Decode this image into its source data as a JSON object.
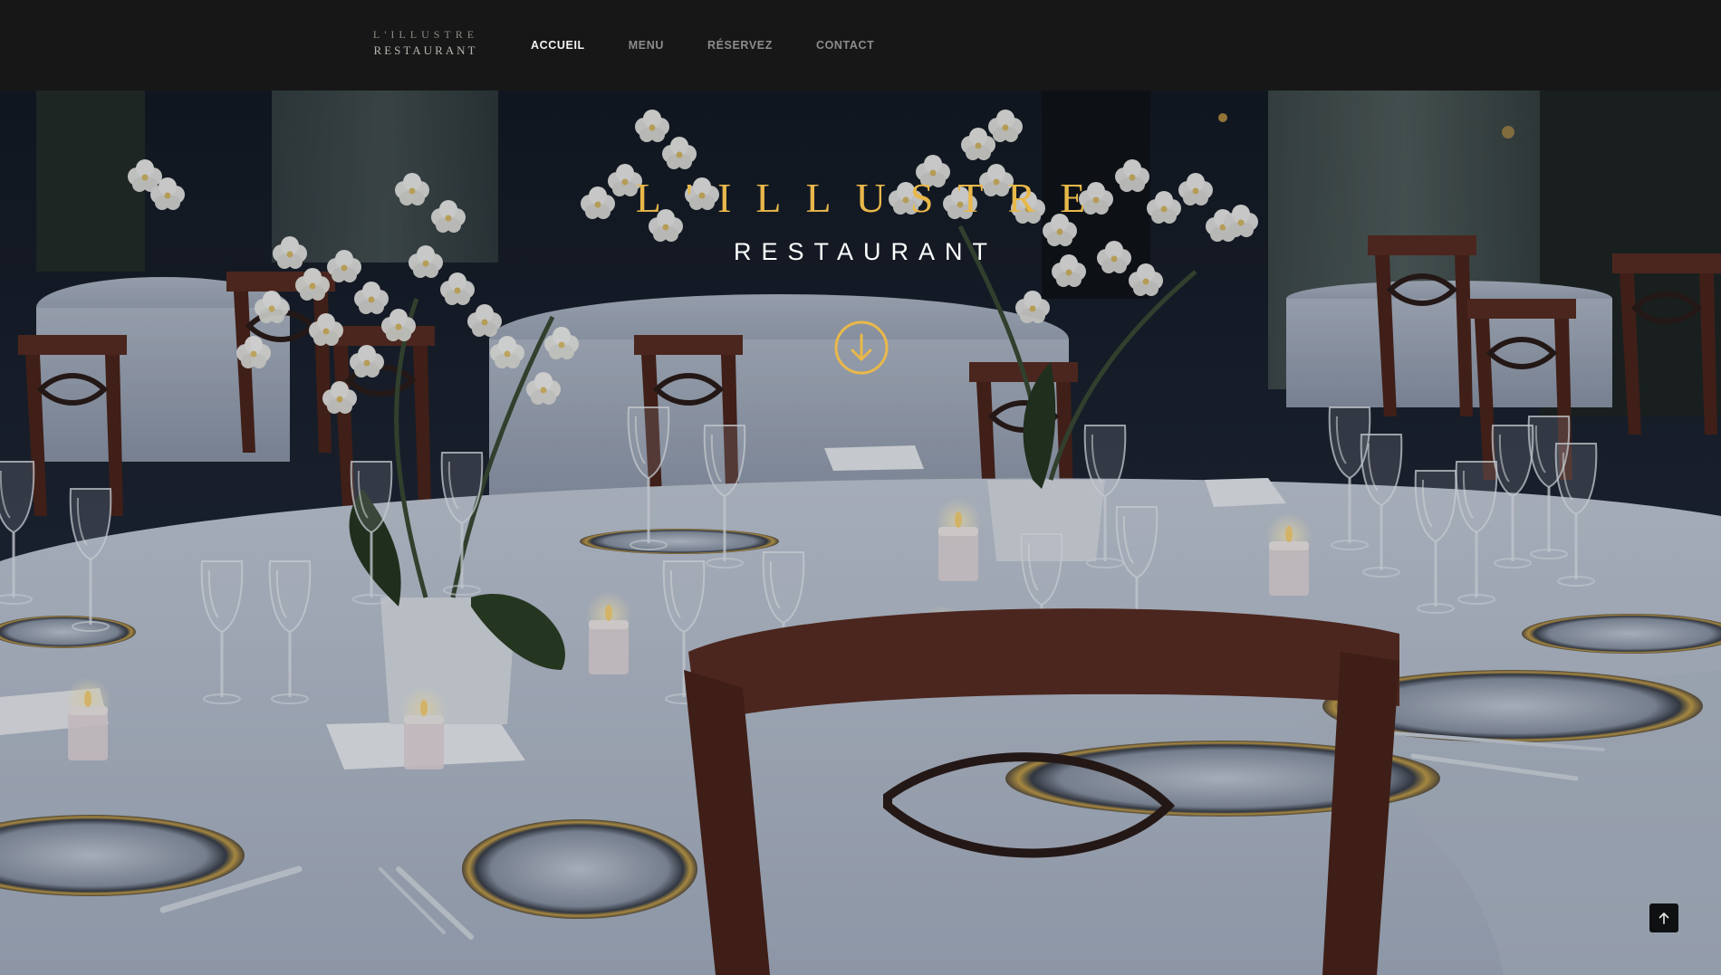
{
  "brand": {
    "line1": "L'ILLUSTRE",
    "line2": "RESTAURANT"
  },
  "nav": {
    "items": [
      {
        "label": "ACCUEIL",
        "active": true
      },
      {
        "label": "MENU",
        "active": false
      },
      {
        "label": "RÉSERVEZ",
        "active": false
      },
      {
        "label": "CONTACT",
        "active": false
      }
    ]
  },
  "hero": {
    "title": "L'ILLUSTRE",
    "subtitle": "RESTAURANT",
    "scroll_icon": "arrow-down-circle-icon",
    "background": "restaurant dining room photo"
  },
  "back_to_top": {
    "icon": "arrow-up-icon"
  },
  "colors": {
    "accent_gold": "#e9b84a",
    "navbar_bg": "#171717",
    "nav_active": "#f2f2f2",
    "nav_inactive": "#8c8c8c"
  }
}
